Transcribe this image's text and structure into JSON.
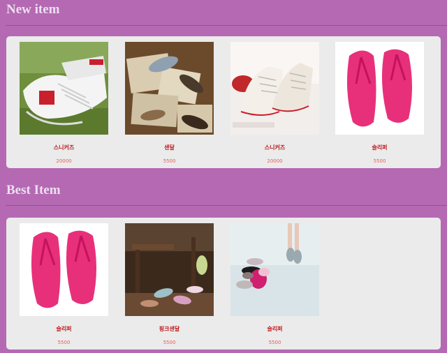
{
  "sections": [
    {
      "title": "New item",
      "items": [
        {
          "name": "스니커즈",
          "price": "20000",
          "image": "white sneakers on grass"
        },
        {
          "name": "샌달",
          "price": "5500",
          "image": "sandals on newspapers"
        },
        {
          "name": "스니커즈",
          "price": "20000",
          "image": "white high-top sneakers"
        },
        {
          "name": "슬리퍼",
          "price": "5500",
          "image": "pink flip-flops"
        }
      ]
    },
    {
      "title": "Best Item",
      "items": [
        {
          "name": "슬리퍼",
          "price": "5500",
          "image": "pink flip-flops"
        },
        {
          "name": "핑크샌달",
          "price": "5500",
          "image": "sandals on wooden chair"
        },
        {
          "name": "슬리퍼",
          "price": "5500",
          "image": "pink sandals on white floor"
        }
      ]
    }
  ],
  "colors": {
    "background": "#b569b3",
    "panel": "#ebebeb",
    "title": "#ecdff0",
    "product_name": "#c0171b",
    "price": "#e0605a"
  }
}
